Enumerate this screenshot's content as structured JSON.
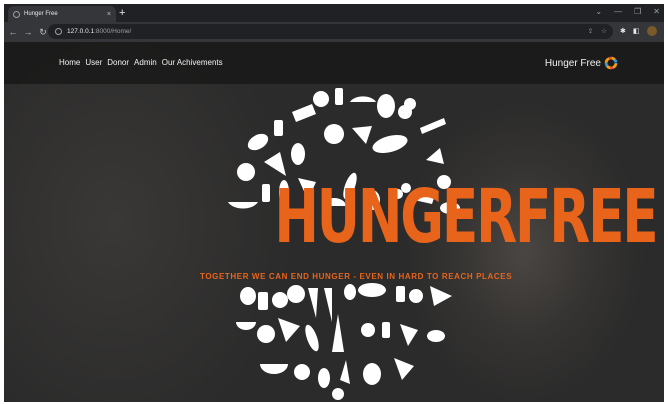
{
  "browser": {
    "tab_title": "Hunger Free",
    "tab_close": "×",
    "new_tab": "+",
    "url_host": "127.0.0.1",
    "url_path": ":8000/Home/",
    "window_controls": [
      "⌄",
      "—",
      "❐",
      "✕"
    ]
  },
  "navbar": {
    "links": [
      "Home",
      "User",
      "Donor",
      "Admin",
      "Our Achivements"
    ],
    "brand": "Hunger Free"
  },
  "hero": {
    "logo_text": "HUNGERFREE",
    "tagline": "TOGETHER WE CAN END HUNGER - EVEN IN HARD TO REACH PLACES"
  },
  "colors": {
    "accent": "#e8641b",
    "background": "#2b2b2b",
    "food_icons": "#ffffff"
  },
  "icons": [
    "info-icon",
    "share-icon",
    "star-icon",
    "extensions-icon",
    "sidepanel-icon",
    "profile-avatar",
    "menu-icon"
  ]
}
